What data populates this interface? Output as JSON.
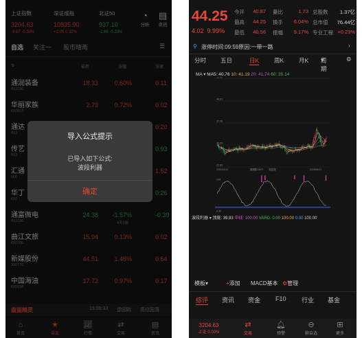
{
  "left": {
    "indices": [
      {
        "name": "上证指数",
        "value": "3204.63",
        "change": "-9.67 -0.30%"
      },
      {
        "name": "深证成指",
        "value": "10835.90",
        "change": "+2.05 0.32%"
      },
      {
        "name": "北证50",
        "value": "937.10",
        "change": "-1.86 -0.20%"
      }
    ],
    "top_icons": [
      {
        "label": "分析",
        "icon": "pie-chart-icon"
      },
      {
        "label": "资讯",
        "icon": "news-icon"
      }
    ],
    "tabs": [
      "自选",
      "关注一",
      "股市晴雨"
    ],
    "columns": [
      "最新",
      "涨幅",
      "涨速"
    ],
    "stocks": [
      {
        "name": "通润装备",
        "code": "002150",
        "price": "18.33",
        "pct": "0.60%",
        "speed": "0.11",
        "color": "red"
      },
      {
        "name": "华丽家族",
        "code": "600503",
        "price": "2.79",
        "pct": "0.72%",
        "speed": "0.02",
        "color": "red"
      },
      {
        "name": "通达",
        "code": "002",
        "price": "",
        "pct": "",
        "speed": "0.20",
        "color": "red"
      },
      {
        "name": "传艺",
        "code": "002",
        "price": "",
        "pct": "",
        "speed": "0.93",
        "color": "grn"
      },
      {
        "name": "汇通",
        "code": "000",
        "price": "",
        "pct": "",
        "speed": "1.52",
        "color": "red"
      },
      {
        "name": "华丁",
        "code": "600",
        "price": "",
        "pct": "",
        "speed": "0.26",
        "color": "grn"
      },
      {
        "name": "通富微电",
        "code": "002156",
        "price": "24.38",
        "pct": "-1.57%",
        "pct_sub": "4天1板",
        "speed": "-0.39",
        "color": "grn"
      },
      {
        "name": "曲江文旅",
        "code": "600706",
        "price": "15.94",
        "pct": "0.13%",
        "speed": "0.02",
        "color": "red"
      },
      {
        "name": "新媒股份",
        "code": "300770",
        "price": "44.51",
        "pct": "1.46%",
        "speed": "0.64",
        "color": "red"
      },
      {
        "name": "中国海油",
        "code": "600938",
        "price": "17.72",
        "pct": "0.97%",
        "speed": "0.17",
        "color": "red"
      }
    ],
    "dialog": {
      "title": "导入公式提示",
      "line1": "已导入如下公式:",
      "line2": "波段利器",
      "ok": "确定"
    },
    "bottombar": {
      "brand": "盘面精灵",
      "time": "15:00:33",
      "btn1": "逆回购",
      "btn2": "高位回落"
    },
    "nav": [
      {
        "label": "首页",
        "icon": "home-icon"
      },
      {
        "label": "自选",
        "icon": "star-icon"
      },
      {
        "label": "行情",
        "icon": "chart-icon"
      },
      {
        "label": "交易",
        "icon": "trade-icon"
      },
      {
        "label": "资讯",
        "icon": "news-icon"
      }
    ]
  },
  "right": {
    "price": "44.25",
    "change": "4.02",
    "change_pct": "9.99%",
    "quote": [
      {
        "k": "今开",
        "v": "40.87",
        "k2": "量比",
        "v2": "1.73",
        "u2": "总股数",
        "v3": "1.37亿"
      },
      {
        "k": "最高",
        "v": "44.25",
        "k2": "换手",
        "v2": "6.04%",
        "u2": "总市值",
        "v3": "76.44亿"
      },
      {
        "k": "最低",
        "v": "40.56",
        "k2": "振幅",
        "v2": "9.17%",
        "u2": "专业工程",
        "v3": "+0.23%"
      }
    ],
    "limit_info": "涨停时间:09:59原因:一带一路",
    "periods": [
      "分时",
      "五日",
      "日K",
      "周K",
      "月K",
      "周期"
    ],
    "active_period": "日K",
    "ma": {
      "label": "MA",
      "ma5": "MA5: 40.76",
      "ma10": "10: 41.19",
      "ma20": "20: 41.74",
      "ma60": "60: 35.14"
    },
    "macd": {
      "name": "波段利器",
      "a": "顶底: 39.93",
      "b": "中线: 100.00",
      "c": "VARD: 0.00",
      "d": "100.00",
      "e": "0.00",
      "f": "100.00"
    },
    "chart_axis": {
      "y": [
        "51.92",
        "44.61",
        "37.30",
        "30.00",
        "22.69"
      ],
      "x_start": "2022/11/10",
      "x_mid": "周期数130个",
      "x_mid2": "前复权",
      "x_end": "2023/06/01"
    },
    "sub_axis": {
      "top": "100",
      "bottom": "0.00"
    },
    "toolrow": {
      "template": "模板",
      "add": "添加",
      "macd": "MACD基本",
      "manage": "管理"
    },
    "ftabs": [
      "综评",
      "资讯",
      "资金",
      "F10",
      "行业",
      "基金"
    ],
    "nav": [
      {
        "label": "上证",
        "value": "3204.63",
        "pct": "0.00%"
      },
      {
        "label": "交易",
        "icon": "trade-icon"
      },
      {
        "label": "预警",
        "icon": "bell-icon"
      },
      {
        "label": "删自选",
        "icon": "remove-icon"
      },
      {
        "label": "更多",
        "icon": "grid-icon"
      }
    ]
  }
}
